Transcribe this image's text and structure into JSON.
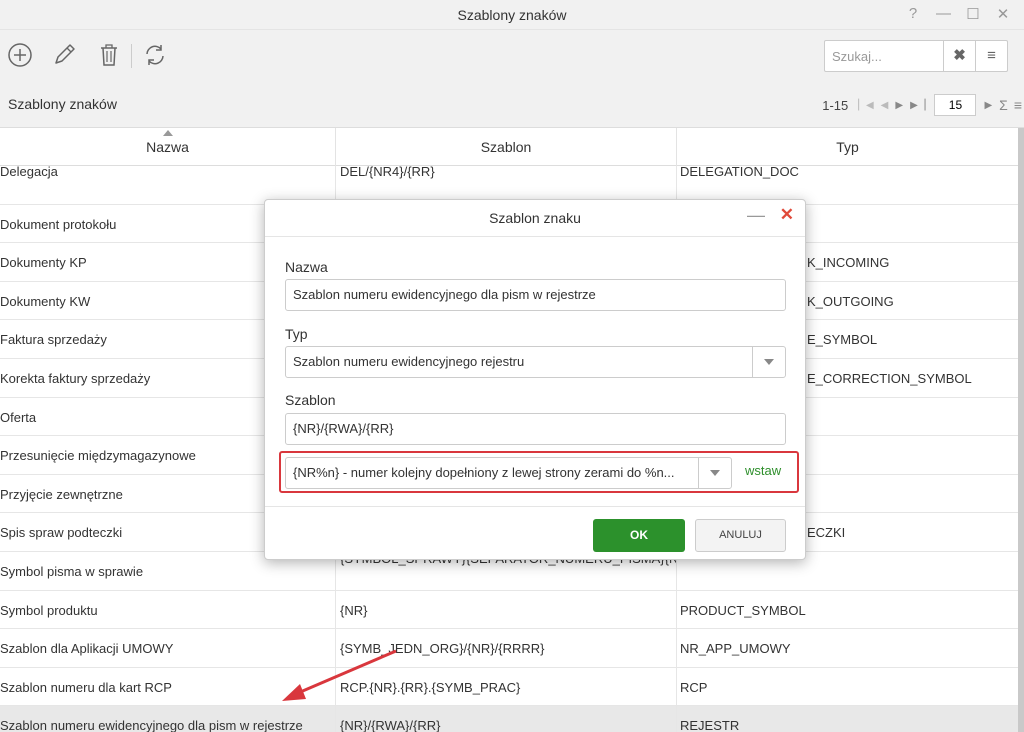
{
  "window": {
    "title": "Szablony znaków",
    "controls": [
      "?",
      "—",
      "☐",
      "✕"
    ]
  },
  "toolbar": {
    "icons": [
      "add-icon",
      "edit-icon",
      "delete-icon",
      "refresh-icon"
    ],
    "search": {
      "placeholder": "Szukaj...",
      "clear": "✖",
      "menu": "≡"
    }
  },
  "grid": {
    "title": "Szablony znaków",
    "pager": {
      "range": "1-15",
      "page_size": "15"
    },
    "columns": [
      "Nazwa",
      "Szablon",
      "Typ"
    ],
    "sorted_column": "Nazwa",
    "rows": [
      {
        "name": "Delegacja",
        "template": "DEL/{NR4}/{RR}",
        "type": "DELEGATION_DOC"
      },
      {
        "name": "Dokument protokołu",
        "template": "",
        "type": ""
      },
      {
        "name": "Dokumenty KP",
        "template": "",
        "type": "K_INCOMING"
      },
      {
        "name": "Dokumenty KW",
        "template": "",
        "type": "K_OUTGOING"
      },
      {
        "name": "Faktura sprzedaży",
        "template": "",
        "type": "E_SYMBOL"
      },
      {
        "name": "Korekta faktury sprzedaży",
        "template": "",
        "type": "E_CORRECTION_SYMBOL"
      },
      {
        "name": "Oferta",
        "template": "",
        "type": ""
      },
      {
        "name": "Przesunięcie międzymagazynowe",
        "template": "",
        "type": ""
      },
      {
        "name": "Przyjęcie zewnętrzne",
        "template": "",
        "type": ""
      },
      {
        "name": "Spis spraw podteczki",
        "template": "",
        "type": "ECZKI"
      },
      {
        "name": "Symbol pisma w sprawie",
        "template": "{SYMBOL_SPRAWY}{SEPARATOR_NUMERU_PISMA}{NR_PAPER_SYMBOL",
        "type": ""
      },
      {
        "name": "Symbol produktu",
        "template": "{NR}",
        "type": "PRODUCT_SYMBOL"
      },
      {
        "name": "Szablon dla Aplikacji UMOWY",
        "template": "{SYMB_JEDN_ORG}/{NR}/{RRRR}",
        "type": "NR_APP_UMOWY"
      },
      {
        "name": "Szablon numeru dla kart RCP",
        "template": "RCP.{NR}.{RR}.{SYMB_PRAC}",
        "type": "RCP"
      },
      {
        "name": "Szablon numeru ewidencyjnego dla pism w rejestrze",
        "template": "{NR}/{RWA}/{RR}",
        "type": "REJESTR"
      }
    ],
    "selected_row": 14
  },
  "modal": {
    "title": "Szablon znaku",
    "minimize": "—",
    "close": "✕",
    "name_label": "Nazwa",
    "name_value": "Szablon numeru ewidencyjnego dla pism w rejestrze",
    "type_label": "Typ",
    "type_value": "Szablon numeru ewidencyjnego rejestru",
    "template_label": "Szablon",
    "template_value": "{NR}/{RWA}/{RR}",
    "variable_value": "{NR%n} - numer kolejny dopełniony z lewej strony zerami do %n...",
    "insert_label": "wstaw",
    "ok_label": "OK",
    "cancel_label": "ANULUJ"
  },
  "colors": {
    "accent_green": "#2c912c",
    "highlight_red": "#d9373d",
    "close_red": "#e04a3a"
  }
}
